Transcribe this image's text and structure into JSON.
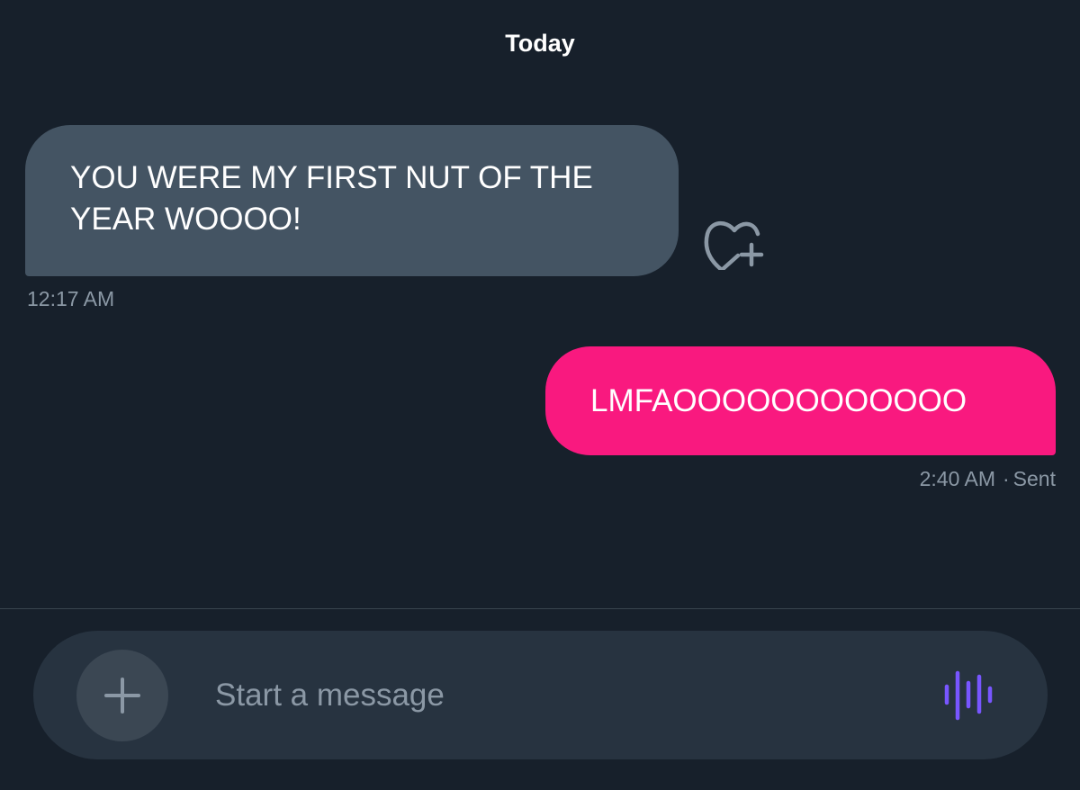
{
  "conversation": {
    "date_divider": "Today",
    "messages": [
      {
        "direction": "received",
        "text": "YOU WERE MY FIRST NUT OF THE YEAR WOOOO!",
        "timestamp": "12:17 AM",
        "bubble_color": "#445463",
        "reaction_icon": "heart-plus-icon"
      },
      {
        "direction": "sent",
        "text": "LMFAOOOOOOOOOOOO",
        "timestamp": "2:40 AM",
        "status": "Sent",
        "separator": "·",
        "bubble_color": "#f9197f"
      }
    ]
  },
  "composer": {
    "placeholder": "Start a message",
    "value": "",
    "add_icon": "plus-icon",
    "voice_icon": "voice-waveform-icon",
    "voice_color": "#7856ff"
  },
  "theme": {
    "background": "#17202b",
    "timestamp_color": "#8b98a5"
  }
}
